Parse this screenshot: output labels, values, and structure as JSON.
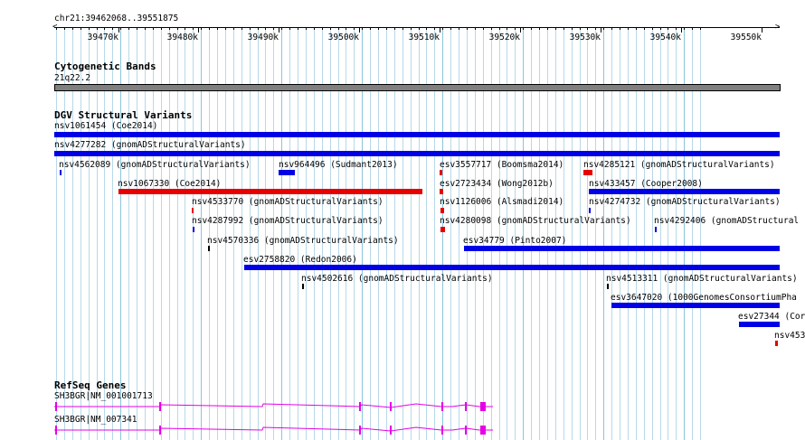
{
  "ruler": {
    "region": "chr21:39462068..39551875",
    "ticks": [
      "39470k",
      "39480k",
      "39490k",
      "39500k",
      "39510k",
      "39520k",
      "39530k",
      "39540k",
      "39550k"
    ]
  },
  "cytobands": {
    "title": "Cytogenetic Bands",
    "band": "21q22.2"
  },
  "dgv": {
    "title": "DGV Structural Variants",
    "features": [
      {
        "label": "nsv1061454 (Coe2014)",
        "color": "#0000e6"
      },
      {
        "label": "nsv4277282 (gnomADStructuralVariants)",
        "color": "#0000e6"
      },
      {
        "label": "nsv4562089 (gnomADStructuralVariants)",
        "color": "#0000e6"
      },
      {
        "label": "nsv964496 (Sudmant2013)",
        "color": "#0000e6"
      },
      {
        "label": "esv3557717 (Boomsma2014)",
        "color": "#e60000"
      },
      {
        "label": "nsv4285121 (gnomADStructuralVariants)",
        "color": "#e60000"
      },
      {
        "label": "nsv1067330 (Coe2014)",
        "color": "#e60000"
      },
      {
        "label": "esv2723434 (Wong2012b)",
        "color": "#e60000"
      },
      {
        "label": "nsv433457 (Cooper2008)",
        "color": "#0000e6"
      },
      {
        "label": "nsv4533770 (gnomADStructuralVariants)",
        "color": "#e60000"
      },
      {
        "label": "nsv1126006 (Alsmadi2014)",
        "color": "#e60000"
      },
      {
        "label": "nsv4274732 (gnomADStructuralVariants)",
        "color": "#0000e6"
      },
      {
        "label": "nsv4287992 (gnomADStructuralVariants)",
        "color": "#0000e6"
      },
      {
        "label": "nsv4280098 (gnomADStructuralVariants)",
        "color": "#e60000"
      },
      {
        "label": "nsv4292406 (gnomADStructural",
        "color": "#0000e6"
      },
      {
        "label": "nsv4570336 (gnomADStructuralVariants)",
        "color": "#000000"
      },
      {
        "label": "esv34779 (Pinto2007)",
        "color": "#0000e6"
      },
      {
        "label": "esv2758820 (Redon2006)",
        "color": "#0000e6"
      },
      {
        "label": "nsv4502616 (gnomADStructuralVariants)",
        "color": "#000000"
      },
      {
        "label": "nsv4513311 (gnomADStructuralVariants)",
        "color": "#000000"
      },
      {
        "label": "esv3647020 (1000GenomesConsortiumPha",
        "color": "#0000e6"
      },
      {
        "label": "esv27344 (Cor",
        "color": "#0000e6"
      },
      {
        "label": "nsv453",
        "color": "#e60000"
      }
    ]
  },
  "refseq": {
    "title": "RefSeq Genes",
    "genes": [
      {
        "label": "SH3BGR|NM_001001713",
        "color": "#e600e6"
      },
      {
        "label": "SH3BGR|NM_007341",
        "color": "#e600e6"
      }
    ]
  }
}
